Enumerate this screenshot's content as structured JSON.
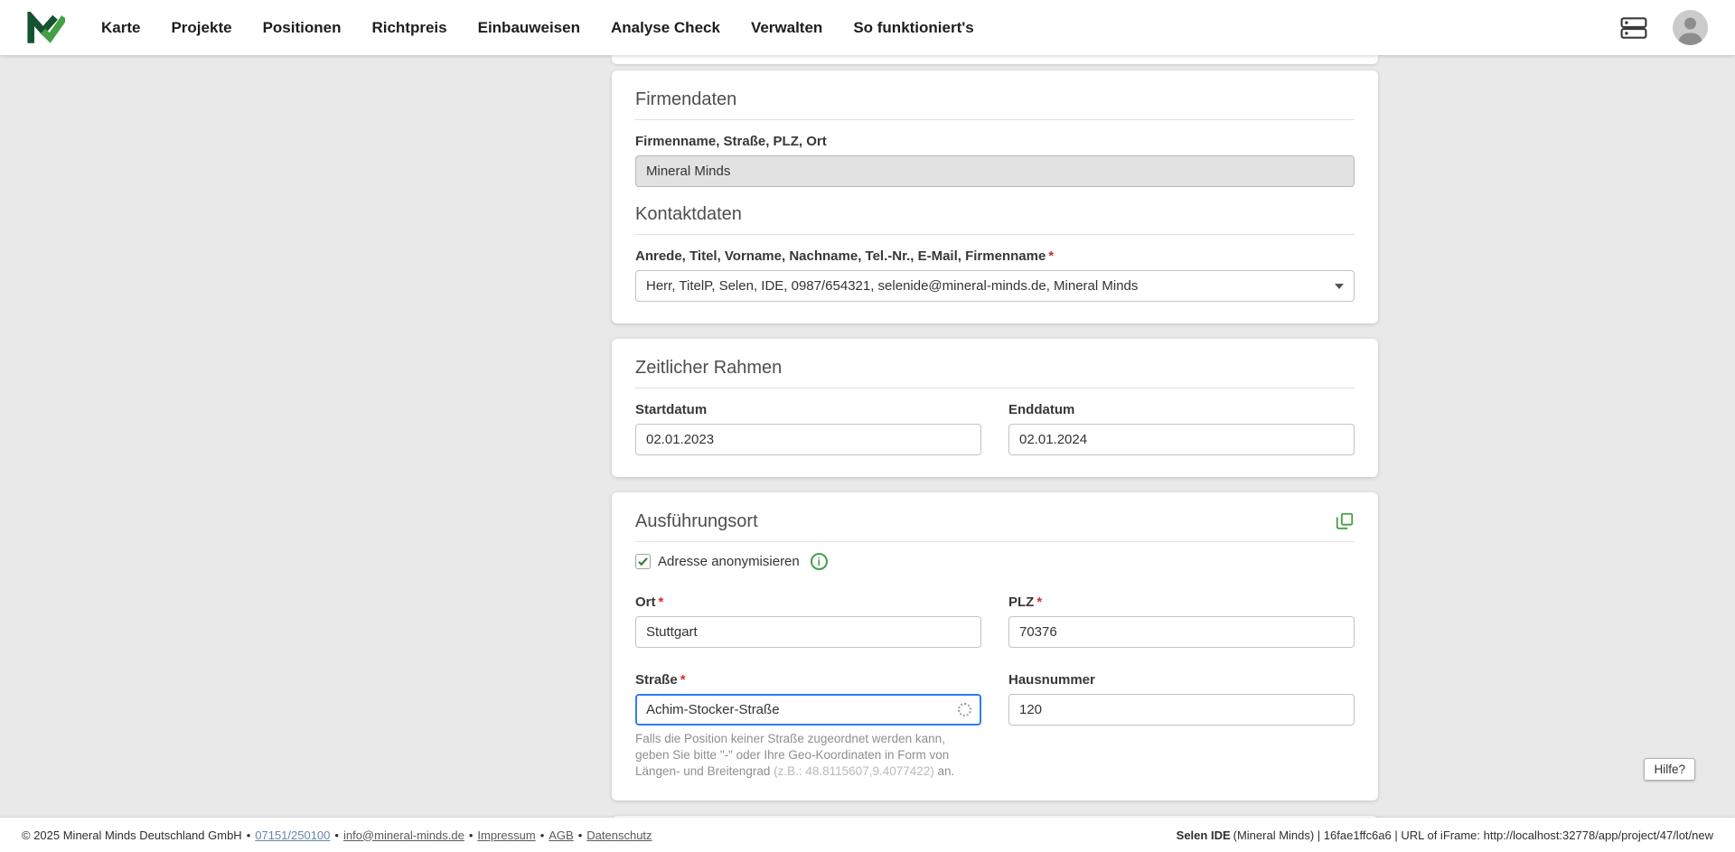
{
  "ui": {
    "required_marker": "*",
    "separator": "•",
    "help_button_label": "Hilfe?"
  },
  "colors": {
    "brand_green": "#43a047",
    "brand_green_dark": "#1b5e20",
    "focus_blue": "#2e7cf6",
    "required_red": "#d32f2f"
  },
  "nav": {
    "items": [
      "Karte",
      "Projekte",
      "Positionen",
      "Richtpreis",
      "Einbauweisen",
      "Analyse Check",
      "Verwalten",
      "So funktioniert's"
    ]
  },
  "company_card": {
    "section1_title": "Firmendaten",
    "company_label": "Firmenname, Straße, PLZ, Ort",
    "company_value": "Mineral Minds",
    "section2_title": "Kontaktdaten",
    "contact_label": "Anrede, Titel, Vorname, Nachname, Tel.-Nr., E-Mail, Firmenname",
    "contact_value": "Herr, TitelP, Selen, IDE, 0987/654321, selenide@mineral-minds.de, Mineral Minds"
  },
  "timeframe_card": {
    "title": "Zeitlicher Rahmen",
    "start_label": "Startdatum",
    "start_value": "02.01.2023",
    "end_label": "Enddatum",
    "end_value": "02.01.2024"
  },
  "location_card": {
    "title": "Ausführungsort",
    "anonymize_label": "Adresse anonymisieren",
    "city_label": "Ort",
    "city_value": "Stuttgart",
    "zip_label": "PLZ",
    "zip_value": "70376",
    "street_label": "Straße",
    "street_value": "Achim-Stocker-Straße",
    "number_label": "Hausnummer",
    "number_value": "120",
    "hint_main": "Falls die Position keiner Straße zugeordnet werden kann, geben Sie bitte \"-\" oder Ihre Geo-Koordinaten in Form von Längen- und Breitengrad ",
    "hint_coords": "(z.B.: 48.8115607,9.4077422)",
    "hint_suffix": " an."
  },
  "footer": {
    "copyright": "© 2025 Mineral Minds Deutschland GmbH",
    "phone_link": "07151/250100",
    "email_link": "info@mineral-minds.de",
    "impressum_link": "Impressum",
    "agb_link": "AGB",
    "datenschutz_link": "Datenschutz",
    "system_name": "Selen IDE",
    "system_info": " (Mineral Minds) | 16fae1ffc6a6 | URL of iFrame: http://localhost:32778/app/project/47/lot/new"
  }
}
